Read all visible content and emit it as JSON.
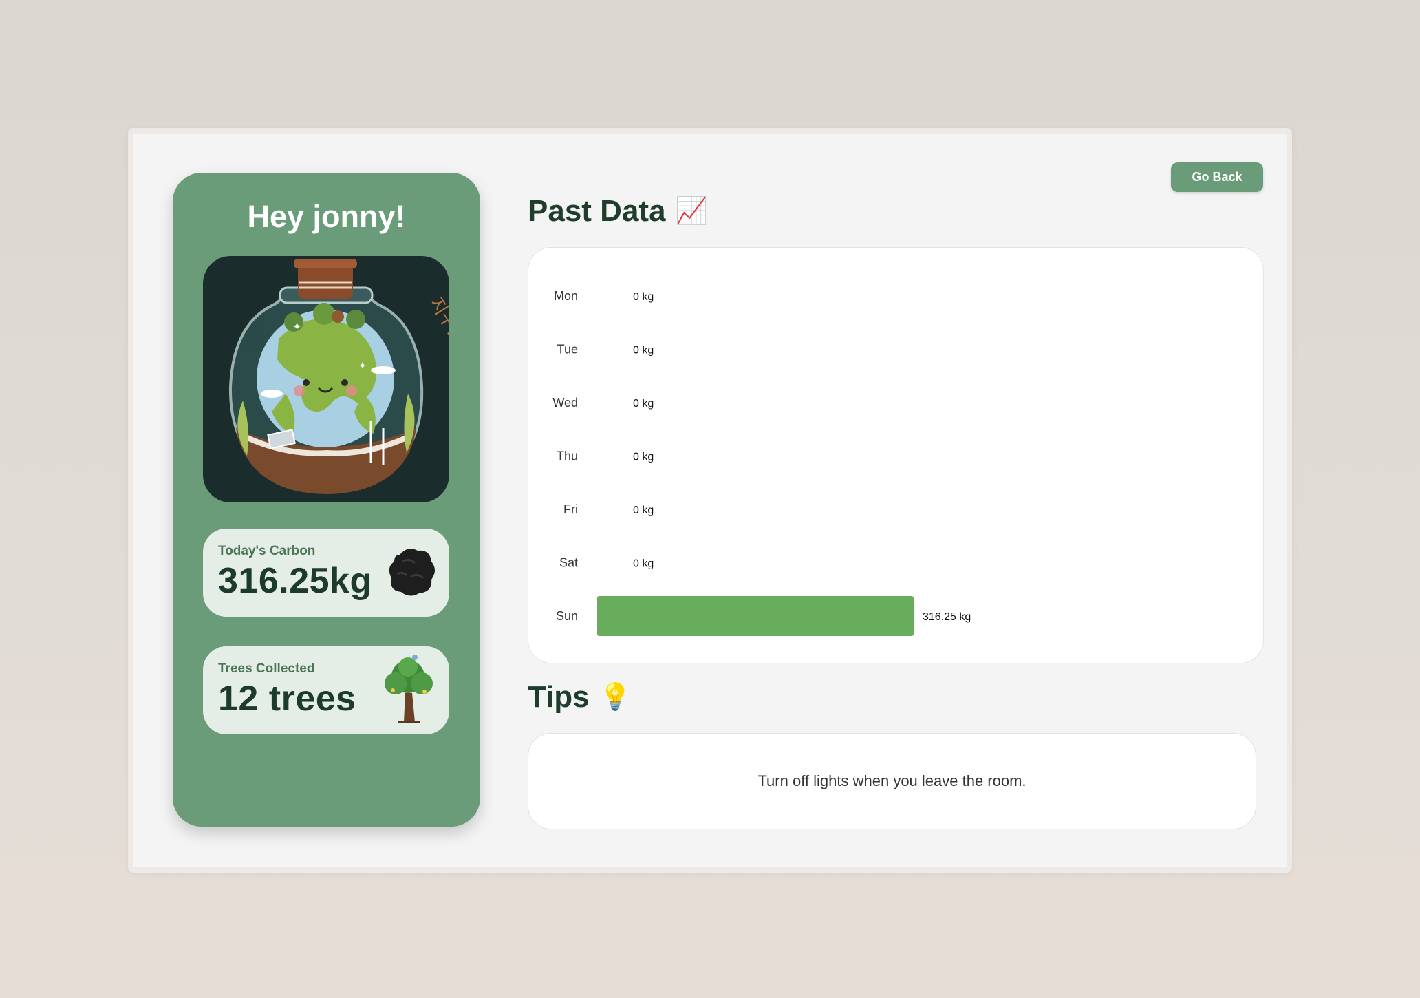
{
  "greeting": "Hey jonny!",
  "earth_image": {
    "subject": "earth-terrarium-illustration",
    "inscription": "지구를 지켜라"
  },
  "stats": {
    "carbon": {
      "label": "Today's Carbon",
      "value": "316.25kg",
      "icon": "coal-icon"
    },
    "trees": {
      "label": "Trees Collected",
      "value": "12 trees",
      "icon": "tree-icon"
    }
  },
  "go_back_label": "Go Back",
  "past_data": {
    "title": "Past Data",
    "emoji": "📈"
  },
  "tips": {
    "title": "Tips",
    "emoji": "💡",
    "text": "Turn off lights when you leave the room."
  },
  "colors": {
    "panel": "#6a9c7a",
    "bar": "#68ad5c",
    "card": "#e5eee6",
    "heading": "#1f3d2b"
  },
  "chart_data": {
    "type": "bar",
    "orientation": "horizontal",
    "categories": [
      "Mon",
      "Tue",
      "Wed",
      "Thu",
      "Fri",
      "Sat",
      "Sun"
    ],
    "values": [
      0,
      0,
      0,
      0,
      0,
      0,
      316.25
    ],
    "unit": "kg",
    "value_labels": [
      "0 kg",
      "0 kg",
      "0 kg",
      "0 kg",
      "0 kg",
      "0 kg",
      "316.25 kg"
    ],
    "xlim": [
      0,
      316.25
    ],
    "grid": false,
    "legend": "none"
  }
}
